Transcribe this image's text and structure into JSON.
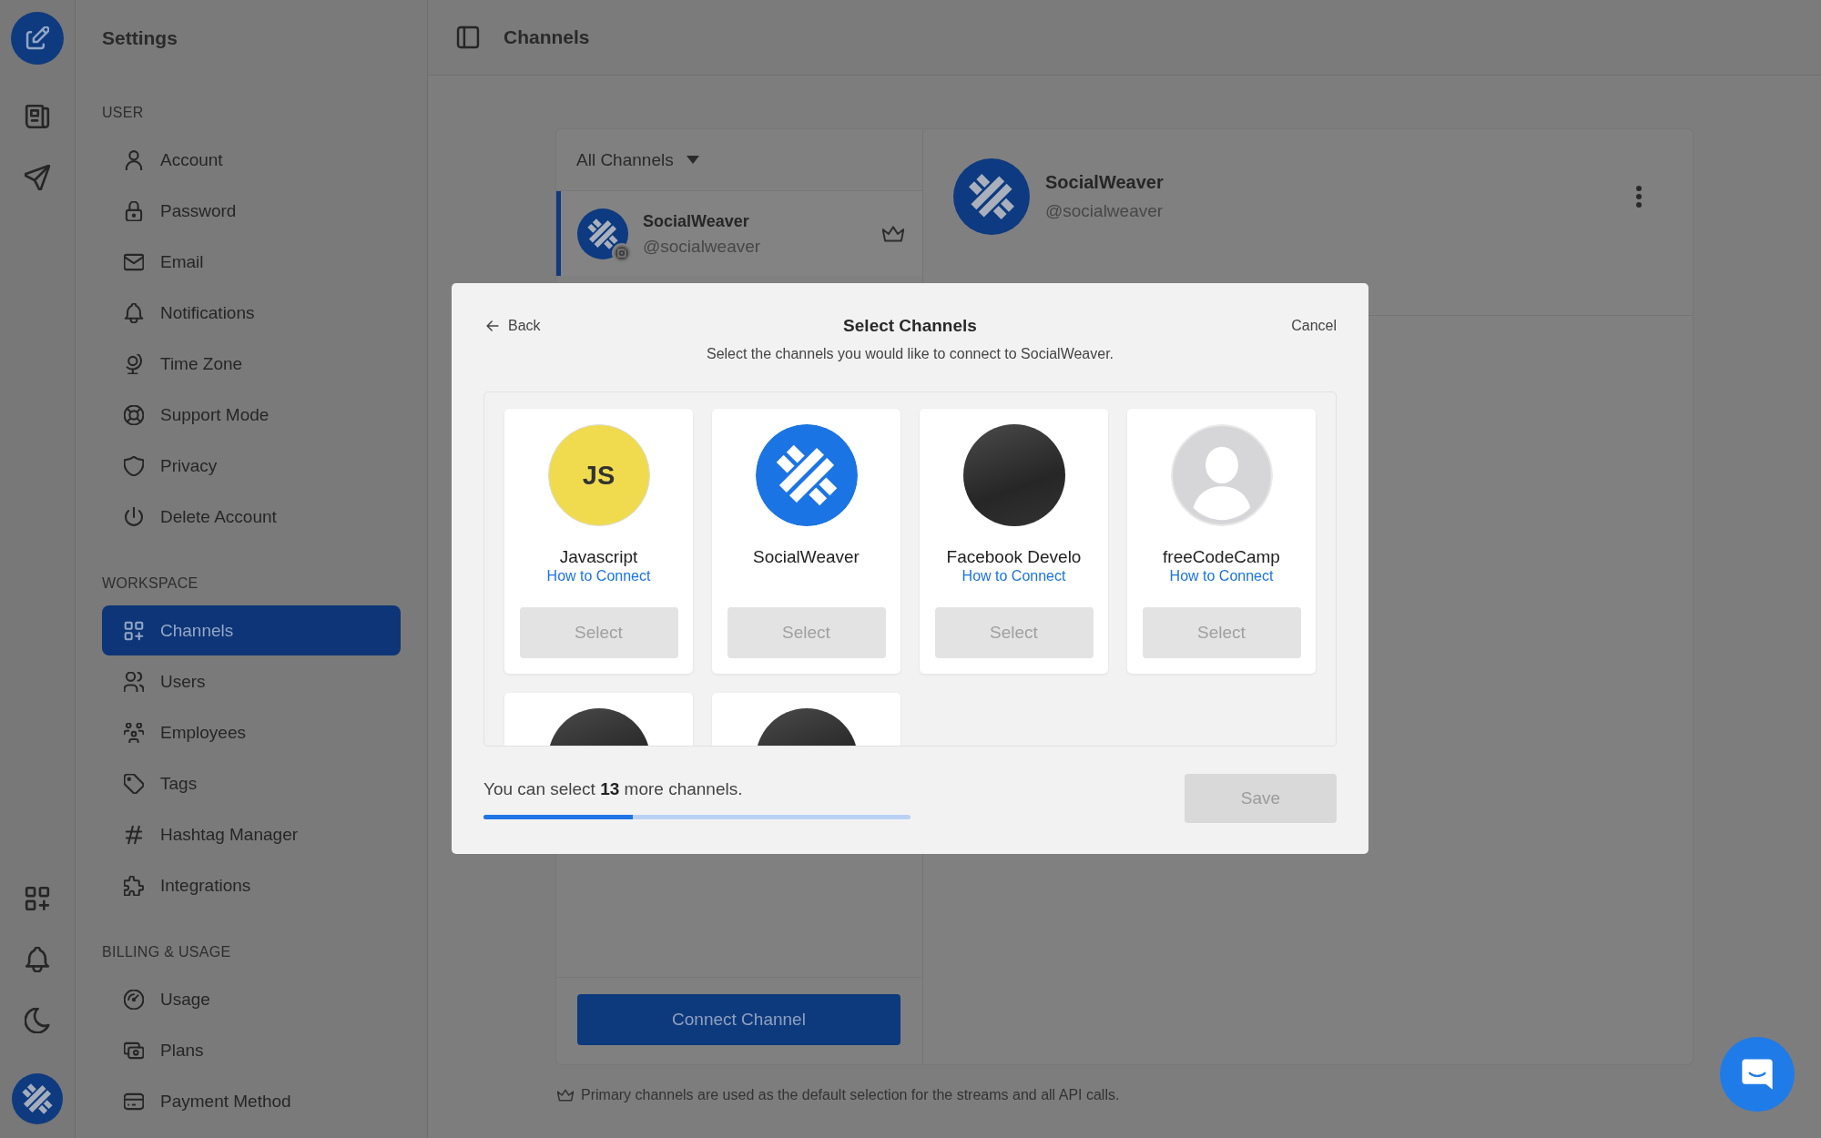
{
  "sidebar": {
    "title": "Settings",
    "sections": [
      {
        "heading": "USER",
        "items": [
          {
            "label": "Account",
            "selected": false
          },
          {
            "label": "Password",
            "selected": false
          },
          {
            "label": "Email",
            "selected": false
          },
          {
            "label": "Notifications",
            "selected": false
          },
          {
            "label": "Time Zone",
            "selected": false
          },
          {
            "label": "Support Mode",
            "selected": false
          },
          {
            "label": "Privacy",
            "selected": false
          },
          {
            "label": "Delete Account",
            "selected": false
          }
        ]
      },
      {
        "heading": "WORKSPACE",
        "items": [
          {
            "label": "Channels",
            "selected": true
          },
          {
            "label": "Users",
            "selected": false
          },
          {
            "label": "Employees",
            "selected": false
          },
          {
            "label": "Tags",
            "selected": false
          },
          {
            "label": "Hashtag Manager",
            "selected": false
          },
          {
            "label": "Integrations",
            "selected": false
          }
        ]
      },
      {
        "heading": "BILLING & USAGE",
        "items": [
          {
            "label": "Usage",
            "selected": false
          },
          {
            "label": "Plans",
            "selected": false
          },
          {
            "label": "Payment Method",
            "selected": false
          }
        ]
      }
    ]
  },
  "header": {
    "title": "Channels"
  },
  "channels_panel": {
    "filter": "All Channels",
    "channels": [
      {
        "name": "SocialWeaver",
        "handle": "@socialweaver",
        "selected": true,
        "primary": true
      }
    ],
    "connect_button": "Connect Channel"
  },
  "channel_detail": {
    "name": "SocialWeaver",
    "handle": "@socialweaver"
  },
  "footnote": "Primary channels are used as the default selection for the streams and all API calls.",
  "modal": {
    "back": "Back",
    "title": "Select Channels",
    "cancel": "Cancel",
    "subtitle": "Select the channels you would like to connect to SocialWeaver.",
    "channels": [
      {
        "kind": "monogram",
        "avatar_text": "JS",
        "name": "Javascript",
        "link": "How to Connect",
        "select_button": {
          "label": "Select",
          "disabled": true
        }
      },
      {
        "kind": "logo",
        "name": "SocialWeaver",
        "select_button": {
          "label": "Select",
          "disabled": true
        }
      },
      {
        "kind": "photo",
        "name": "Facebook Develo",
        "link": "How to Connect",
        "select_button": {
          "label": "Select",
          "disabled": true
        }
      },
      {
        "kind": "silhouette",
        "name": "freeCodeCamp",
        "link": "How to Connect",
        "select_button": {
          "label": "Select",
          "disabled": true
        }
      },
      {
        "kind": "photo"
      },
      {
        "kind": "photo"
      }
    ],
    "remaining": "You can select **13** more channels.",
    "progress": {
      "level": 0.35
    },
    "save_button": {
      "label": "Save",
      "disabled": true
    }
  }
}
